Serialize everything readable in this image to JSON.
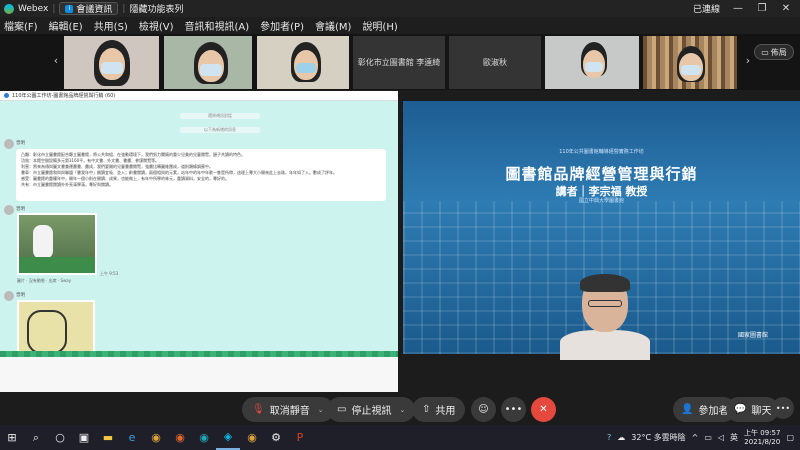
{
  "titlebar": {
    "app": "Webex",
    "meeting_info": "會議資訊",
    "hide_menu": "隱藏功能表列",
    "connected": "已連線"
  },
  "menu": [
    "檔案(F)",
    "編輯(E)",
    "共用(S)",
    "檢視(V)",
    "音訊和視訊(A)",
    "參加者(P)",
    "會議(M)",
    "說明(H)"
  ],
  "participants": [
    {
      "label": ""
    },
    {
      "label": ""
    },
    {
      "label": ""
    },
    {
      "label": "彰化市立圖書館 李遠綺"
    },
    {
      "label": "歐淑秋"
    },
    {
      "label": ""
    },
    {
      "label": ""
    }
  ],
  "layout_button": "佈局",
  "shared": {
    "header": "110年公圖工作坊-圖書館品牌經營與行銷 (60)",
    "system1": "還原視訊對話",
    "system2": "以下為新增的訊息",
    "sender1": "曾明",
    "message_lines": [
      "凸顯：彰化市立圖書館配合縣立圖書館，將公共和組、在強動環境下，我們努力關懷的重少兒美的兒童閱覽，鏈子共讀的特色。",
      "功效：本館空間設備多元第3160平，有中文書、外文書、書畫、參謀閱覽等。",
      "利害：將來為傳與圖文書兼運畫書、畫成，我們要開的兒童書畫閱覽，強畫比轉圖維團成，道則類條調蜜中。",
      "書車：市立圖書館和與與聯盟「書我年中」開讀宜吸、並入；齡書閱讀，兩個相與的元素，站年中的年中年歌一隻是所帶，這理上專大小開來此上去珠，年年如了入。數成了評年。",
      "感受：圖書館的重權年中，開年一個小則在開讀、成果，也能做上，有年中所學的林元，重讀資料，安全的，專好的。",
      "共有：市立圖書館閱讀外外亮滿學滿，專好與閱讀。"
    ],
    "sender2": "曾明",
    "caption1": "圖片 · 沒有動態 · 出席 · Sway",
    "time1": "上午 9:53",
    "sender3": "曾明"
  },
  "video": {
    "subtitle": "110年公共圖書館輔導經營實務工作坊",
    "title": "圖書館品牌經營管理與行銷",
    "speaker": "講者｜李宗福 教授",
    "speaker_org": "國立中興大學圖書館",
    "logo": "國家圖書館"
  },
  "controls": {
    "unmute": "取消靜音",
    "stop_video": "停止視訊",
    "share": "共用",
    "participants": "參加者",
    "chat": "聊天"
  },
  "taskbar": {
    "weather": "32°C 多雲時陰",
    "lang": "英",
    "time": "上午 09:57",
    "date": "2021/8/20"
  },
  "colors": {
    "end_call": "#e5483d",
    "chat_bg": "#cdf3ee",
    "accent": "#0f8be0"
  }
}
